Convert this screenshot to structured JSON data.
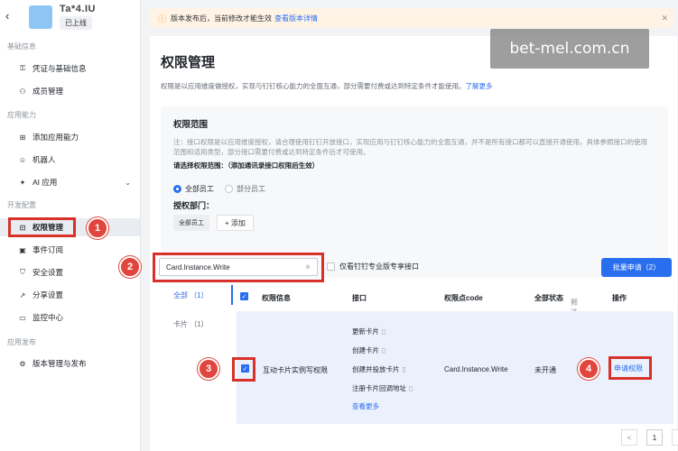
{
  "app": {
    "name": "Ta*4.IU",
    "status": "已上线",
    "back_icon": "chevron-left-icon"
  },
  "sidebar": {
    "sections": [
      {
        "title": "基础信息",
        "items": [
          {
            "label": "凭证与基础信息",
            "icon": "key-icon"
          },
          {
            "label": "成员管理",
            "icon": "user-icon"
          }
        ]
      },
      {
        "title": "应用能力",
        "items": [
          {
            "label": "添加应用能力",
            "icon": "grid-icon"
          },
          {
            "label": "机器人",
            "icon": "robot-icon"
          },
          {
            "label": "AI 应用",
            "icon": "ai-icon"
          }
        ]
      },
      {
        "title": "开发配置",
        "items": [
          {
            "label": "权限管理",
            "icon": "lock-icon"
          },
          {
            "label": "事件订阅",
            "icon": "event-icon"
          },
          {
            "label": "安全设置",
            "icon": "shield-icon"
          },
          {
            "label": "分享设置",
            "icon": "share-icon"
          },
          {
            "label": "监控中心",
            "icon": "monitor-icon"
          }
        ]
      },
      {
        "title": "应用发布",
        "items": [
          {
            "label": "版本管理与发布",
            "icon": "version-icon"
          }
        ]
      }
    ]
  },
  "notice": {
    "text": "版本发布后，当前修改才能生效",
    "link": "查看版本详情"
  },
  "page": {
    "title": "权限管理",
    "desc": "权限是以应用维度做授权，实现与钉钉核心能力的全面互通，部分需要付费或达到特定条件才能使用。",
    "desc_link": "了解更多"
  },
  "scope": {
    "title": "权限范围",
    "note": "注：接口权限是以应用维度授权，请合理使用钉钉开放接口，实现应用与钉钉核心能力的全面互通，并不是所有接口都可以直接开通使用，具体参照接口的使用范围和适用类型，部分接口需要付费或达到特定条件后才可使用。",
    "subtitle": "请选择权限范围：（添加通讯录接口权限后生效）",
    "radio_all": "全部员工",
    "radio_part": "部分员工",
    "dept_label": "授权部门：",
    "dept_chip": "全部员工",
    "add_label": "+ 添加"
  },
  "toolbar": {
    "search_value": "Card.Instance.Write",
    "only_pro_label": "仅看钉钉专业版专享接口",
    "batch_label": "批量申请（2）"
  },
  "categories": {
    "all": "全部 （1）",
    "card": "卡片 （1）"
  },
  "table": {
    "headers": {
      "info": "权限信息",
      "iface": "接口",
      "code": "权限点code",
      "status": "全部状态",
      "filter": "筛选",
      "op": "操作"
    },
    "row": {
      "name": "互动卡片实例写权限",
      "interfaces": [
        "更新卡片",
        "创建卡片",
        "创建并投放卡片",
        "注册卡片回调地址"
      ],
      "more": "查看更多",
      "code": "Card.Instance.Write",
      "status": "未开通",
      "action": "申请权限"
    }
  },
  "pager": {
    "prev": "<",
    "current": "1",
    "next": ">"
  },
  "badges": [
    "1",
    "2",
    "3",
    "4"
  ],
  "watermark": "bet-mel.com.cn",
  "colors": {
    "accent": "#2a6ef0",
    "highlight": "#d9302a",
    "badge": "#e0463d"
  }
}
